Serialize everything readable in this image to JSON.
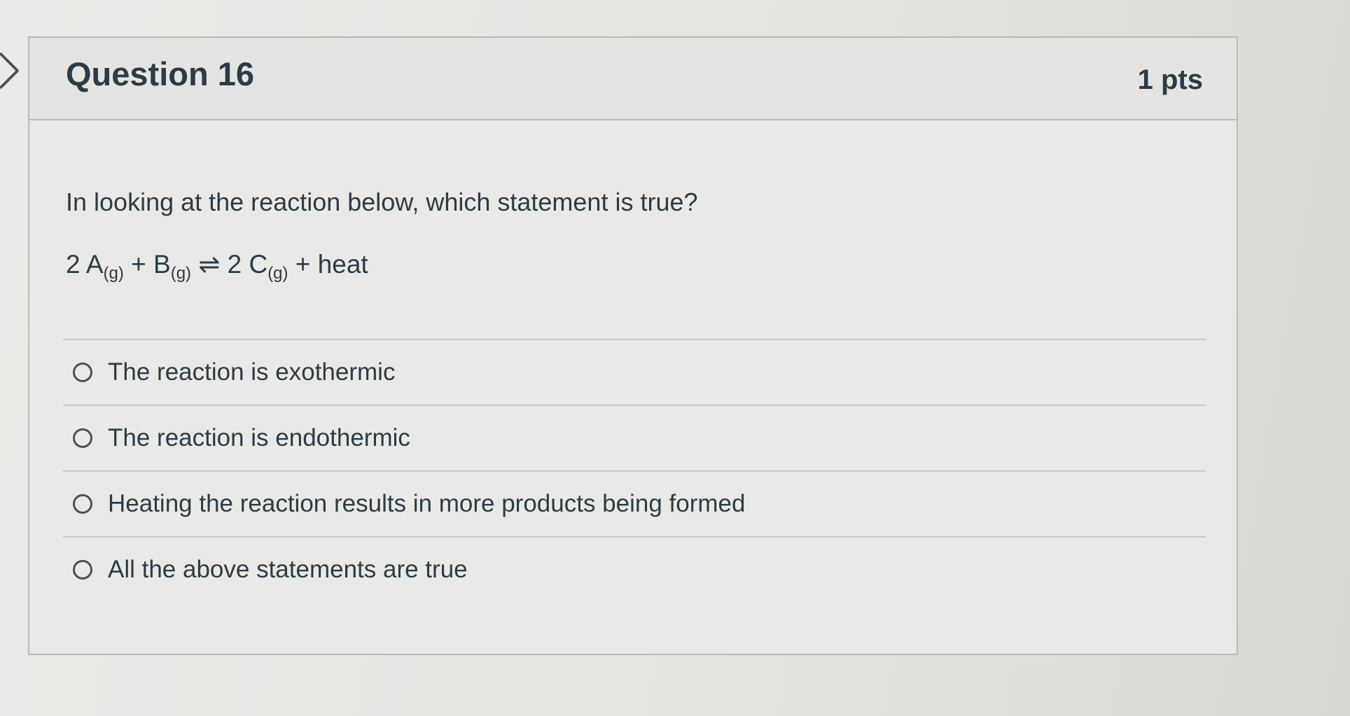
{
  "question": {
    "title": "Question 16",
    "points": "1 pts",
    "text": "In looking at the reaction below, which statement is true?",
    "equation": {
      "coef_a": "2 A",
      "state_a": "(g)",
      "plus1": " + B",
      "state_b": "(g)",
      "arrow": " ⇌ 2 C",
      "state_c": "(g)",
      "tail": " + heat"
    }
  },
  "answers": [
    {
      "label": "The reaction is exothermic"
    },
    {
      "label": "The reaction is endothermic"
    },
    {
      "label": "Heating the reaction results in more products being formed"
    },
    {
      "label": "All the above statements are true"
    }
  ],
  "icons": {
    "flag": "bookmark-flag-icon",
    "radio": "radio-circle-icon"
  }
}
